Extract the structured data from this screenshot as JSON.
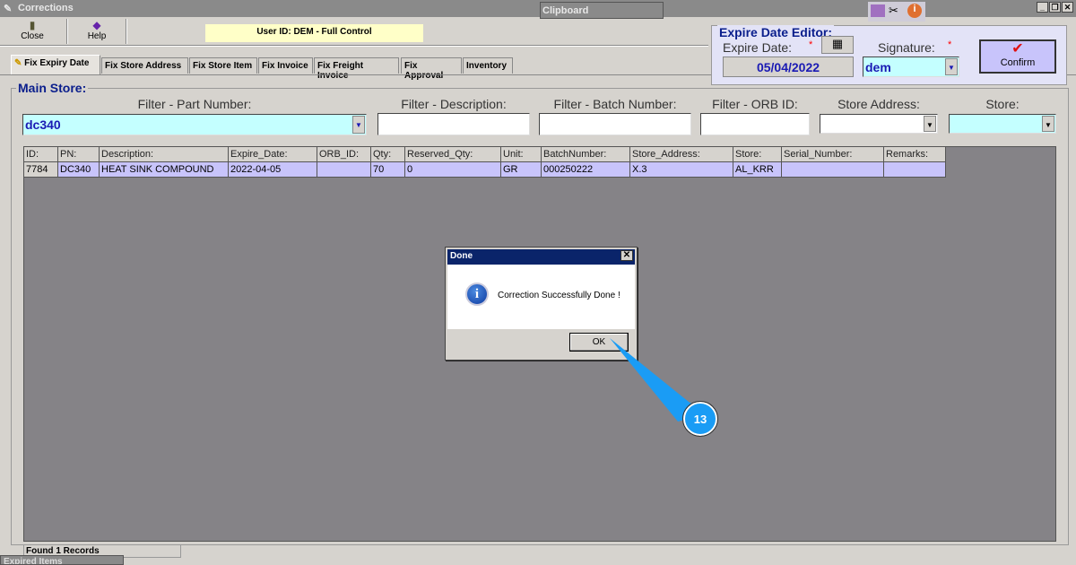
{
  "window": {
    "title": "Corrections",
    "clipboard_tab": "Clipboard",
    "buttons": [
      "_",
      "❐",
      "✕"
    ]
  },
  "toolbar": {
    "close": "Close",
    "help": "Help",
    "user_info": "User ID: DEM - Full Control"
  },
  "tabs": [
    {
      "label": "Fix Expiry Date",
      "active": true
    },
    {
      "label": "Fix Store Address"
    },
    {
      "label": "Fix Store Item"
    },
    {
      "label": "Fix Invoice"
    },
    {
      "label": "Fix Freight Invoice"
    },
    {
      "label": "Fix Approval"
    },
    {
      "label": "Inventory"
    }
  ],
  "editor": {
    "title": "Expire Date Editor:",
    "expire_label": "Expire Date:",
    "expire_value": "05/04/2022",
    "signature_label": "Signature:",
    "signature_value": "dem",
    "required": "*",
    "confirm": "Confirm"
  },
  "main": {
    "title": "Main Store:",
    "filters": {
      "part_label": "Filter - Part Number:",
      "part_value": "dc340",
      "desc_label": "Filter - Description:",
      "batch_label": "Filter - Batch Number:",
      "orb_label": "Filter - ORB ID:",
      "address_label": "Store Address:",
      "store_label": "Store:"
    },
    "columns": [
      "ID:",
      "PN:",
      "Description:",
      "Expire_Date:",
      "ORB_ID:",
      "Qty:",
      "Reserved_Qty:",
      "Unit:",
      "BatchNumber:",
      "Store_Address:",
      "Store:",
      "Serial_Number:",
      "Remarks:"
    ],
    "rows": [
      [
        "7784",
        "DC340",
        "HEAT SINK COMPOUND",
        "2022-04-05",
        "",
        "70",
        "0",
        "GR",
        "000250222",
        "X.3",
        "AL_KRR",
        "",
        ""
      ]
    ],
    "status": "Found 1 Records"
  },
  "bottom_tab": "Expired Items",
  "dialog": {
    "title": "Done",
    "message": "Correction Successfully Done !",
    "ok": "OK"
  },
  "annotation": {
    "step": "13",
    "color": "#1a9cf5"
  }
}
